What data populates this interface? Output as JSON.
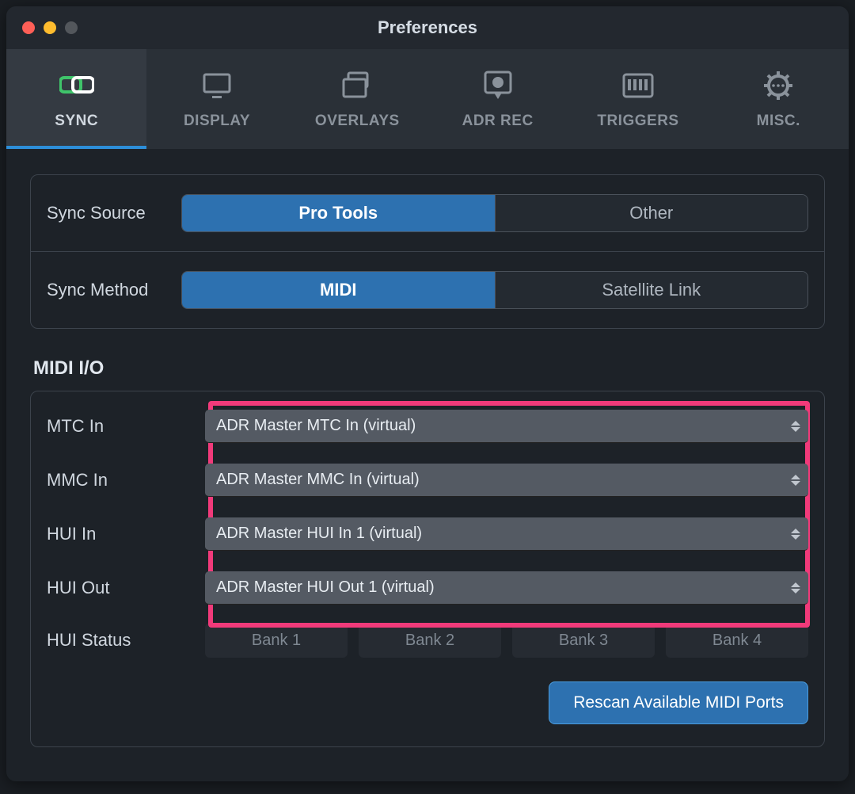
{
  "window": {
    "title": "Preferences"
  },
  "tabs": {
    "sync": "SYNC",
    "display": "DISPLAY",
    "overlays": "OVERLAYS",
    "adrrec": "ADR REC",
    "triggers": "TRIGGERS",
    "misc": "MISC."
  },
  "source": {
    "label": "Sync Source",
    "opt_protools": "Pro Tools",
    "opt_other": "Other"
  },
  "method": {
    "label": "Sync Method",
    "opt_midi": "MIDI",
    "opt_sat": "Satellite Link"
  },
  "midi": {
    "heading": "MIDI I/O",
    "mtc_label": "MTC In",
    "mtc_value": "ADR Master MTC In (virtual)",
    "mmc_label": "MMC In",
    "mmc_value": "ADR Master MMC In (virtual)",
    "huiin_label": "HUI In",
    "huiin_value": "ADR Master HUI In 1 (virtual)",
    "huiout_label": "HUI Out",
    "huiout_value": "ADR Master HUI Out 1 (virtual)",
    "status_label": "HUI Status",
    "bank1": "Bank 1",
    "bank2": "Bank 2",
    "bank3": "Bank 3",
    "bank4": "Bank 4",
    "rescan": "Rescan Available MIDI Ports"
  }
}
